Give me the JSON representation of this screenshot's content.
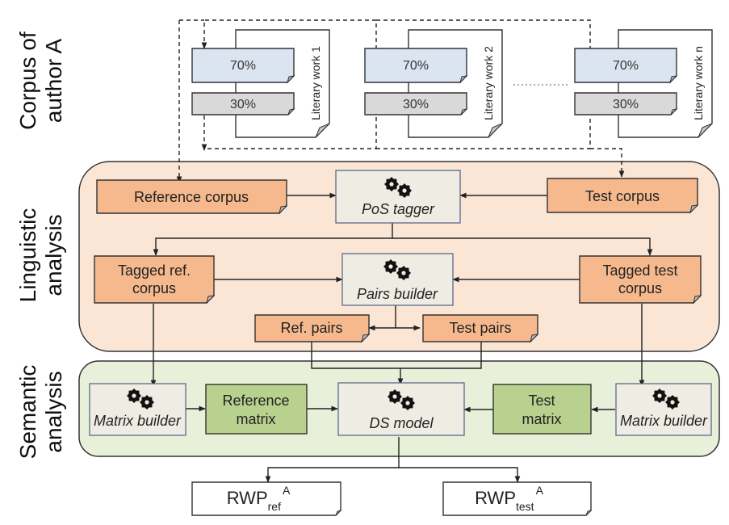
{
  "colors": {
    "linguistic_panel": "#fbe6d6",
    "semantic_panel": "#e8f0da",
    "orange_doc": "#f6b98d",
    "green_matrix": "#b9d18f",
    "process_box": "#eeece3",
    "split_train": "#dbe4f1",
    "split_test": "#d9d9d9"
  },
  "section_labels": {
    "corpus": [
      "Corpus of",
      "author A"
    ],
    "linguistic": [
      "Linguistic",
      "analysis"
    ],
    "semantic": [
      "Semantic",
      "analysis"
    ]
  },
  "corpus": {
    "works": [
      {
        "title": "Literary work 1",
        "train_split": "70%",
        "test_split": "30%"
      },
      {
        "title": "Literary work 2",
        "train_split": "70%",
        "test_split": "30%"
      },
      {
        "title": "Literary work n",
        "train_split": "70%",
        "test_split": "30%"
      }
    ]
  },
  "linguistic": {
    "reference_corpus": "Reference corpus",
    "test_corpus": "Test corpus",
    "pos_tagger": "PoS tagger",
    "tagged_ref": [
      "Tagged ref.",
      "corpus"
    ],
    "tagged_test": [
      "Tagged test",
      "corpus"
    ],
    "pairs_builder": "Pairs builder",
    "ref_pairs": "Ref. pairs",
    "test_pairs": "Test pairs"
  },
  "semantic": {
    "matrix_builder_left": "Matrix builder",
    "reference_matrix": [
      "Reference",
      "matrix"
    ],
    "ds_model": "DS model",
    "test_matrix": [
      "Test",
      "matrix"
    ],
    "matrix_builder_right": "Matrix builder"
  },
  "outputs": {
    "rwp_ref": {
      "base": "RWP",
      "sub": "ref",
      "sup": "A"
    },
    "rwp_test": {
      "base": "RWP",
      "sub": "test",
      "sup": "A"
    }
  }
}
